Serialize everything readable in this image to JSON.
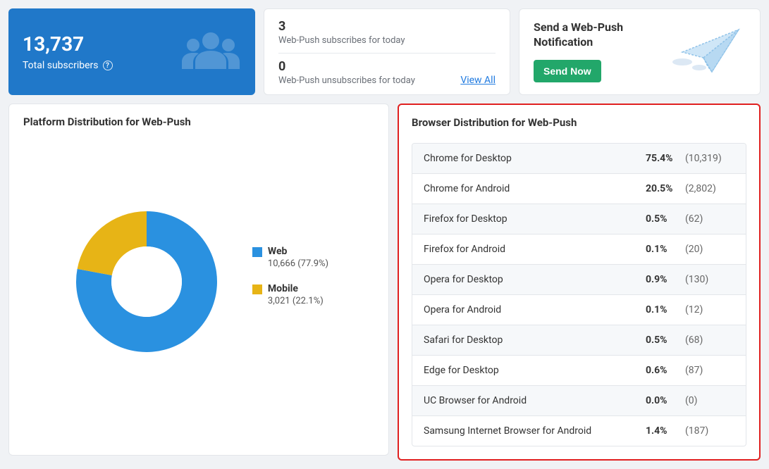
{
  "summary": {
    "total_value": "13,737",
    "total_label": "Total subscribers"
  },
  "today": {
    "subs_value": "3",
    "subs_label": "Web-Push subscribes for today",
    "unsubs_value": "0",
    "unsubs_label": "Web-Push unsubscribes for today",
    "view_all": "View All"
  },
  "send": {
    "title": "Send a Web-Push Notification",
    "button": "Send Now"
  },
  "platform": {
    "title": "Platform Distribution for Web-Push",
    "legend": [
      {
        "label": "Web",
        "detail": "10,666 (77.9%)",
        "color": "#2a91e0"
      },
      {
        "label": "Mobile",
        "detail": "3,021 (22.1%)",
        "color": "#e7b416"
      }
    ]
  },
  "browser": {
    "title": "Browser Distribution for Web-Push",
    "rows": [
      {
        "name": "Chrome for Desktop",
        "pct": "75.4%",
        "count": "(10,319)"
      },
      {
        "name": "Chrome for Android",
        "pct": "20.5%",
        "count": "(2,802)"
      },
      {
        "name": "Firefox for Desktop",
        "pct": "0.5%",
        "count": "(62)"
      },
      {
        "name": "Firefox for Android",
        "pct": "0.1%",
        "count": "(20)"
      },
      {
        "name": "Opera for Desktop",
        "pct": "0.9%",
        "count": "(130)"
      },
      {
        "name": "Opera for Android",
        "pct": "0.1%",
        "count": "(12)"
      },
      {
        "name": "Safari for Desktop",
        "pct": "0.5%",
        "count": "(68)"
      },
      {
        "name": "Edge for Desktop",
        "pct": "0.6%",
        "count": "(87)"
      },
      {
        "name": "UC Browser for Android",
        "pct": "0.0%",
        "count": "(0)"
      },
      {
        "name": "Samsung Internet Browser for Android",
        "pct": "1.4%",
        "count": "(187)"
      }
    ]
  },
  "chart_data": {
    "type": "pie",
    "title": "Platform Distribution for Web-Push",
    "series": [
      {
        "name": "Web",
        "value": 10666,
        "pct": 77.9,
        "color": "#2a91e0"
      },
      {
        "name": "Mobile",
        "value": 3021,
        "pct": 22.1,
        "color": "#e7b416"
      }
    ],
    "donut_hole_ratio": 0.5
  }
}
